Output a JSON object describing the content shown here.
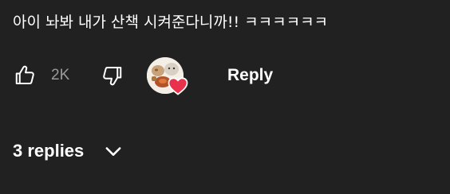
{
  "comment": {
    "text": "아이 놔봐 내가 산책 시켜준다니까!! ㅋㅋㅋㅋㅋㅋ"
  },
  "actions": {
    "like_icon": "thumbs-up-icon",
    "like_count": "2K",
    "dislike_icon": "thumbs-down-icon",
    "creator_heart_icon": "heart-icon",
    "reply_label": "Reply"
  },
  "replies": {
    "label": "3 replies",
    "icon": "chevron-down-icon"
  },
  "colors": {
    "background": "#212121",
    "text": "#ffffff",
    "muted": "#9a9a9a",
    "heart": "#e8314a"
  }
}
